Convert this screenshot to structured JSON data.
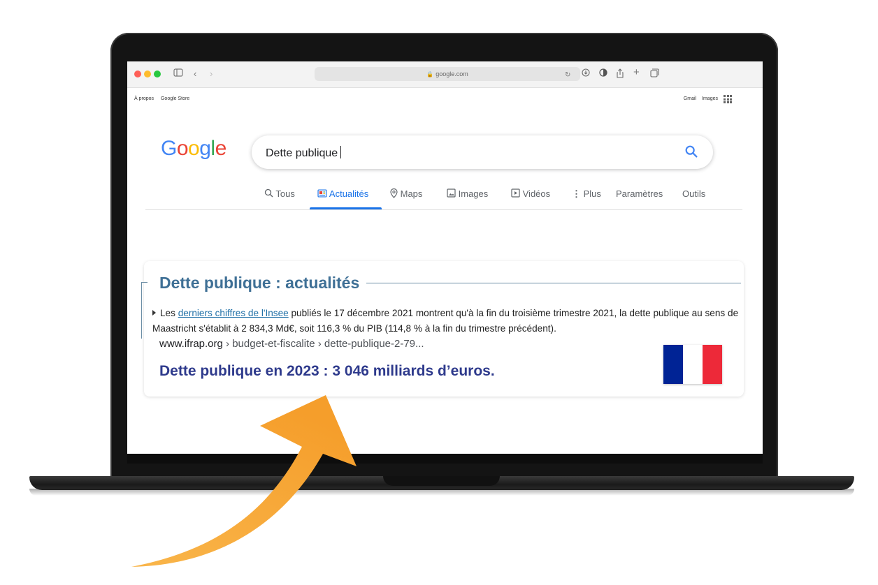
{
  "browser": {
    "url": "google.com",
    "traffic_lights": [
      "#fe5f57",
      "#febc2e",
      "#28c840"
    ]
  },
  "google": {
    "top_left_links": [
      "À propos",
      "Google Store"
    ],
    "top_right_links": [
      "Gmail",
      "Images"
    ],
    "logo": [
      "G",
      "o",
      "o",
      "g",
      "l",
      "e"
    ],
    "query": "Dette publique",
    "tabs": [
      {
        "label": "Tous",
        "icon": "search-icon"
      },
      {
        "label": "Actualités",
        "icon": "news-icon",
        "active": true
      },
      {
        "label": "Maps",
        "icon": "map-pin-icon"
      },
      {
        "label": "Images",
        "icon": "image-icon"
      },
      {
        "label": "Vidéos",
        "icon": "video-icon"
      },
      {
        "label": "Plus",
        "icon": "more-vert-icon"
      },
      {
        "label": "Paramètres"
      },
      {
        "label": "Outils"
      }
    ]
  },
  "card": {
    "title": "Dette publique : actualités",
    "snippet_prefix": "Les ",
    "snippet_link": "derniers chiffres de l'Insee",
    "snippet_text": " publiés le 17 décembre 2021 montrent qu'à la fin du troisième trimestre 2021, la dette publique au sens de Maastricht s'établit à 2 834,3 Md€, soit 116,3 % du PIB (114,8 % à la fin du trimestre précédent).",
    "site_domain": "www.ifrap.org",
    "site_path": " › budget-et-fiscalite › dette-publique-2-79...",
    "headline": "Dette publique en 2023 : 3 046 milliards d’euros.",
    "flag_colors": [
      "#002395",
      "#ffffff",
      "#ed2939"
    ]
  },
  "colors": {
    "arrow": "#f7a93a",
    "accent": "#1a73e8",
    "headline": "#2e3a8c"
  }
}
